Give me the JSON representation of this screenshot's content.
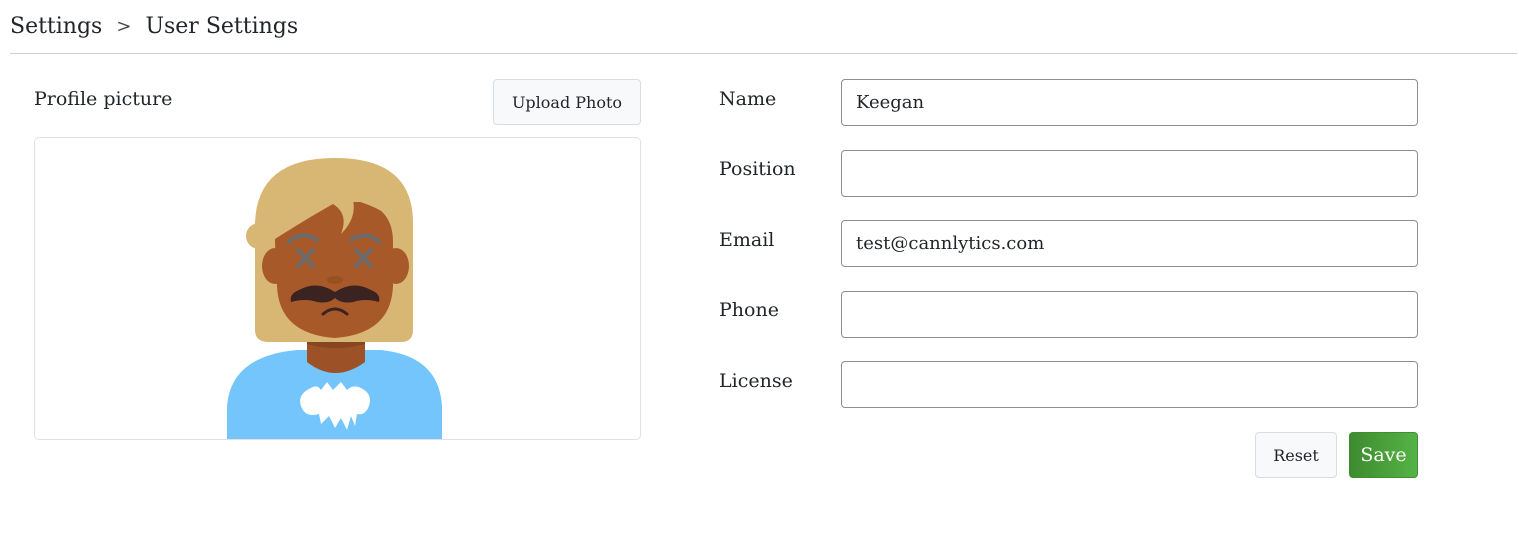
{
  "breadcrumb": {
    "root": "Settings",
    "separator": ">",
    "current": "User Settings"
  },
  "profile": {
    "label": "Profile picture",
    "upload_label": "Upload Photo",
    "avatar_icon": "avatar-illustration"
  },
  "form": {
    "name_label": "Name",
    "name_value": "Keegan",
    "position_label": "Position",
    "position_value": "",
    "email_label": "Email",
    "email_value": "test@cannlytics.com",
    "phone_label": "Phone",
    "phone_value": "",
    "license_label": "License",
    "license_value": ""
  },
  "actions": {
    "reset_label": "Reset",
    "save_label": "Save"
  },
  "colors": {
    "save_button": "#4ea33f",
    "avatar_hair": "#d8b674",
    "avatar_skin": "#a8592a",
    "avatar_shirt": "#73c5fb"
  }
}
